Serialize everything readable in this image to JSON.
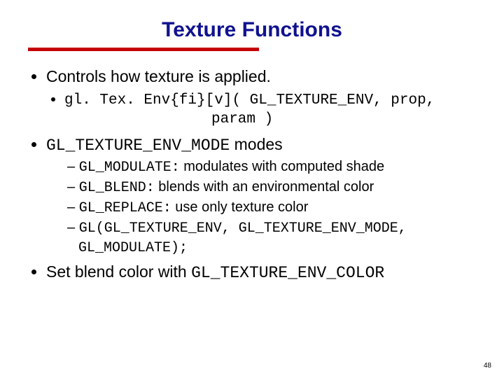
{
  "title": "Texture Functions",
  "bullets": {
    "b1": "Controls how texture is applied.",
    "b1_sub_line1": "gl. Tex. Env{fi}[v]( GL_TEXTURE_ENV, prop,",
    "b1_sub_line2": "param )",
    "b2_code": "GL_TEXTURE_ENV_MODE",
    "b2_tail": " modes",
    "b2_sub1_code": "GL_MODULATE:",
    "b2_sub1_tail": " modulates with computed shade",
    "b2_sub2_code": "GL_BLEND:",
    "b2_sub2_tail": " blends with an environmental color",
    "b2_sub3_code": "GL_REPLACE:",
    "b2_sub3_tail": " use only texture color",
    "b2_sub4": "GL(GL_TEXTURE_ENV, GL_TEXTURE_ENV_MODE, GL_MODULATE);",
    "b3_head": "Set blend color with ",
    "b3_code": "GL_TEXTURE_ENV_COLOR"
  },
  "page_number": "48"
}
